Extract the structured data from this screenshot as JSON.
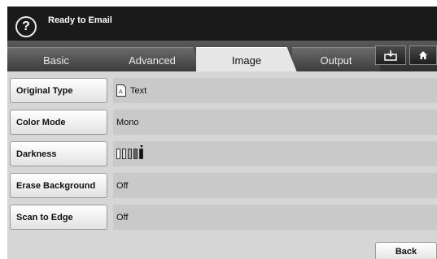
{
  "header": {
    "help_icon": "?",
    "title": "Ready to Email"
  },
  "tabs": {
    "basic": "Basic",
    "advanced": "Advanced",
    "image": "Image",
    "output": "Output"
  },
  "rows": [
    {
      "label": "Original Type",
      "value": "Text",
      "icon": "text-document-icon"
    },
    {
      "label": "Color Mode",
      "value": "Mono"
    },
    {
      "label": "Darkness",
      "value_level": 5,
      "value_max": 5,
      "icon": "darkness-level-icon"
    },
    {
      "label": "Erase Background",
      "value": "Off"
    },
    {
      "label": "Scan to Edge",
      "value": "Off"
    }
  ],
  "back_label": "Back"
}
